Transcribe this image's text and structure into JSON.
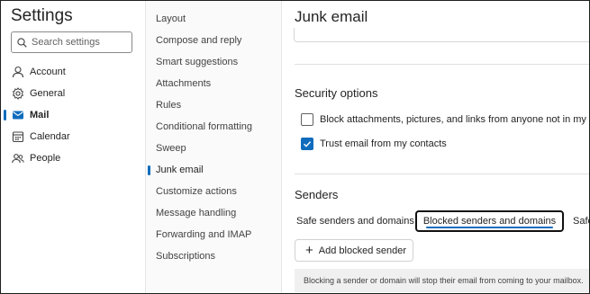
{
  "left_nav": {
    "title": "Settings",
    "search_placeholder": "Search settings",
    "categories": [
      {
        "label": "Account",
        "icon": "person-icon"
      },
      {
        "label": "General",
        "icon": "gear-icon"
      },
      {
        "label": "Mail",
        "icon": "mail-icon",
        "active": true
      },
      {
        "label": "Calendar",
        "icon": "calendar-icon"
      },
      {
        "label": "People",
        "icon": "people-icon"
      }
    ]
  },
  "sub_nav": {
    "items": [
      "Layout",
      "Compose and reply",
      "Smart suggestions",
      "Attachments",
      "Rules",
      "Conditional formatting",
      "Sweep",
      "Junk email",
      "Customize actions",
      "Message handling",
      "Forwarding and IMAP",
      "Subscriptions"
    ],
    "active_index": 7
  },
  "main": {
    "title": "Junk email",
    "security": {
      "heading": "Security options",
      "options": [
        {
          "label": "Block attachments, pictures, and links from anyone not in my Safe",
          "checked": false
        },
        {
          "label": "Trust email from my contacts",
          "checked": true
        }
      ]
    },
    "senders": {
      "heading": "Senders",
      "tabs": [
        "Safe senders and domains",
        "Blocked senders and domains",
        "Safe"
      ],
      "selected_tab": 1,
      "add_button": "Add blocked sender",
      "info": "Blocking a sender or domain will stop their email from coming to your mailbox."
    }
  },
  "colors": {
    "accent": "#0f6cbd"
  }
}
